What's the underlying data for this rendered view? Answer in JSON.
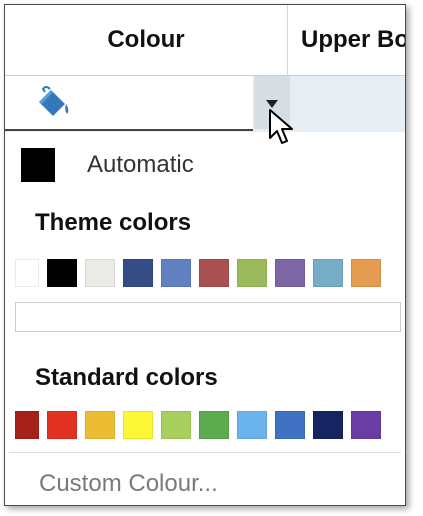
{
  "header": {
    "col1": "Colour",
    "col2": "Upper Bo"
  },
  "picker": {
    "icon": "paint-bucket-icon",
    "dropdown_icon": "caret-down-icon",
    "cursor_icon": "mouse-pointer-icon",
    "bucket_color": "#3577bd"
  },
  "automatic": {
    "label": "Automatic",
    "color": "#000000"
  },
  "theme": {
    "title": "Theme colors",
    "colors": [
      "#ffffff",
      "#000000",
      "#ebebe6",
      "#344d86",
      "#6281c2",
      "#a85150",
      "#9cba5b",
      "#7d66a5",
      "#76adc7",
      "#e59c51"
    ]
  },
  "standard": {
    "title": "Standard colors",
    "colors": [
      "#a7211b",
      "#e13221",
      "#ecbd33",
      "#fcf838",
      "#a8d05f",
      "#5cab4f",
      "#6bb3ec",
      "#3f72c2",
      "#162561",
      "#6a3da4"
    ]
  },
  "custom": {
    "label": "Custom Colour..."
  }
}
